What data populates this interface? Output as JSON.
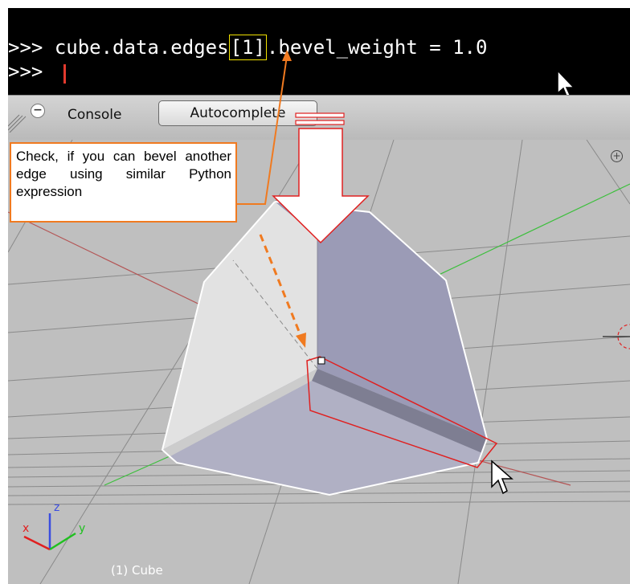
{
  "console": {
    "prompt": ">>>",
    "command_before": "cube.data.edges",
    "command_highlight": "[1]",
    "command_after": ".bevel_weight = 1.0",
    "second_prompt": ">>>"
  },
  "header": {
    "console_label": "Console",
    "autocomplete_label": "Autocomplete"
  },
  "viewport": {
    "object_label": "(1) Cube",
    "axes": {
      "x": "x",
      "y": "y",
      "z": "z"
    }
  },
  "callout": {
    "text": "Check, if you can bevel another edge using similar Python expression"
  },
  "colors": {
    "highlight_box": "#f0e000",
    "callout_border": "#f07a20",
    "selected_edge": "#e02020",
    "cube_light": "#e2e2e2",
    "cube_blue": "#9b9bb6"
  },
  "icons": [
    "cursor-arrow-icon",
    "cursor-arrow-icon",
    "minus-icon",
    "zoom-icon",
    "axis-gizmo-icon",
    "arrow-down-icon"
  ]
}
